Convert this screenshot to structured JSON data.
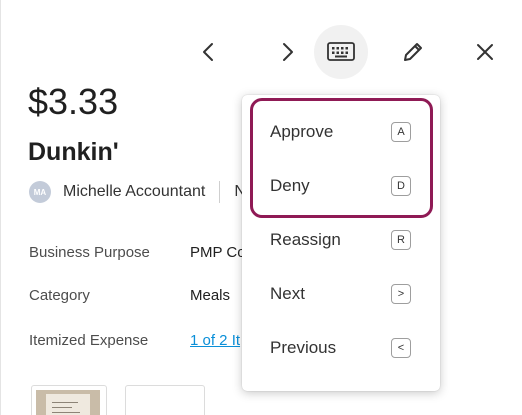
{
  "toolbar": {
    "prev_icon": "chevron-left-icon",
    "next_icon": "chevron-right-icon",
    "keyboard_icon": "keyboard-icon",
    "edit_icon": "pencil-icon",
    "close_icon": "close-icon"
  },
  "expense": {
    "amount": "$3.33",
    "merchant": "Dunkin'",
    "user": {
      "initials": "MA",
      "name": "Michelle Accountant",
      "extra": "N"
    },
    "fields": [
      {
        "label": "Business Purpose",
        "value": "PMP Co"
      },
      {
        "label": "Category",
        "value": "Meals"
      },
      {
        "label": "Itemized Expense",
        "value": "1 of 2 It"
      }
    ]
  },
  "shortcut_menu": {
    "items": [
      {
        "label": "Approve",
        "key": "A"
      },
      {
        "label": "Deny",
        "key": "D"
      },
      {
        "label": "Reassign",
        "key": "R"
      },
      {
        "label": "Next",
        "key": ">"
      },
      {
        "label": "Previous",
        "key": "<"
      }
    ]
  },
  "colors": {
    "highlight": "#8f1a55",
    "link": "#0a8fd8",
    "avatar_bg": "#c3cbd9"
  }
}
